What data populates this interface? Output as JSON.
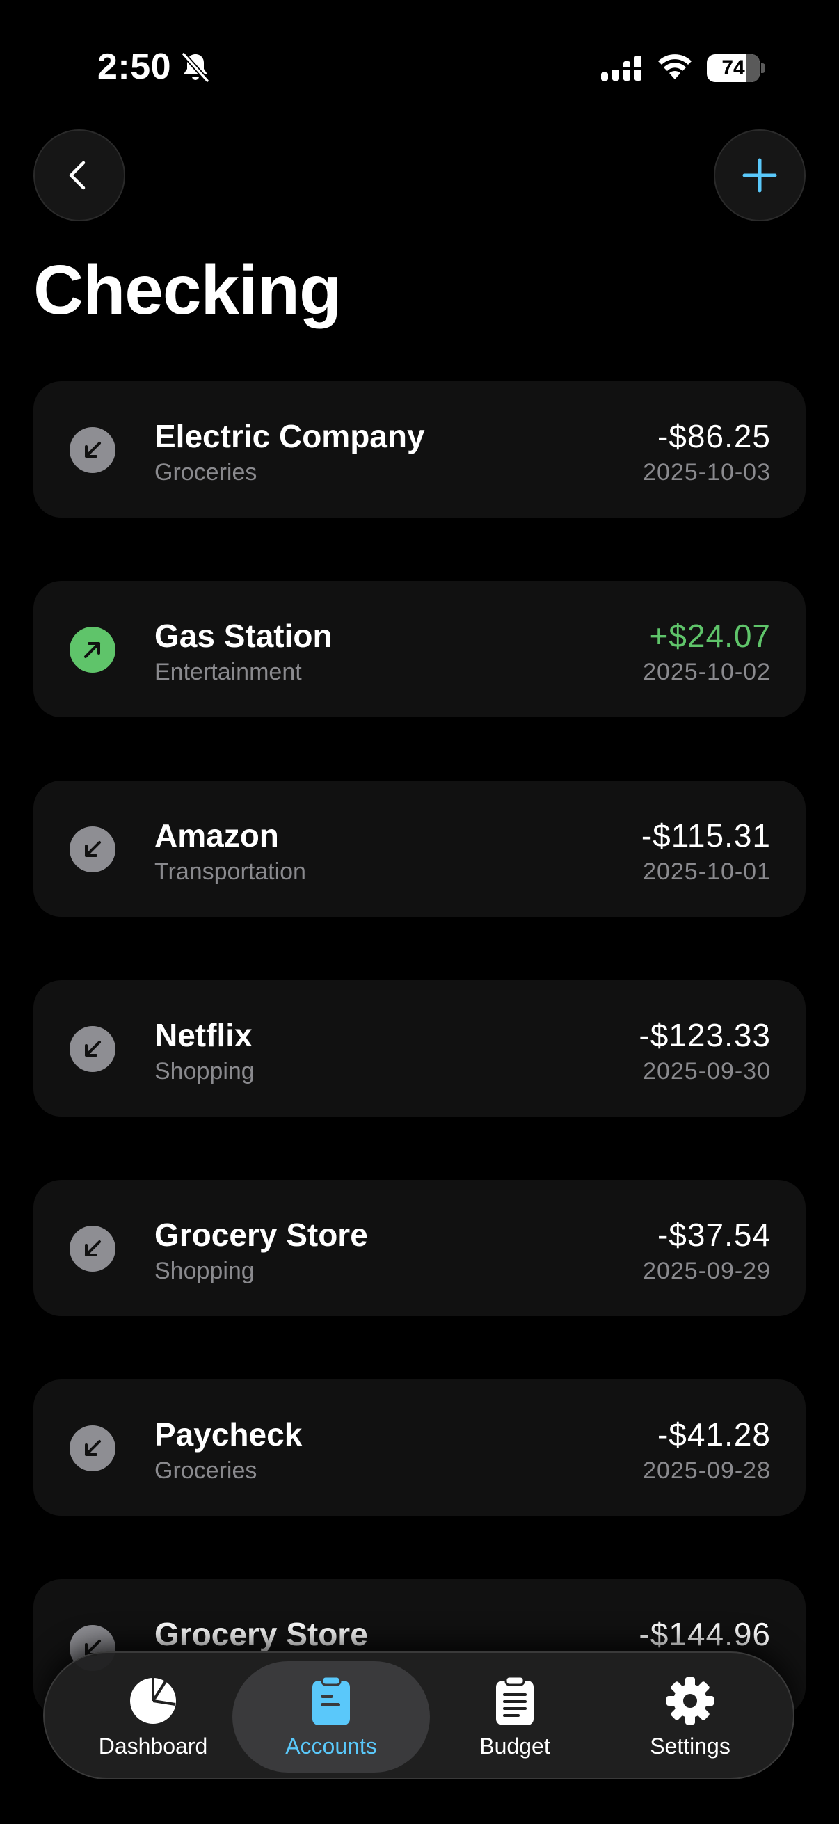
{
  "status_bar": {
    "time": "2:50",
    "battery": "74",
    "battery_level": 0.74
  },
  "header": {
    "back_icon": "chevron-left-icon",
    "add_icon": "plus-icon",
    "title": "Checking",
    "accent": "#5ac8fa"
  },
  "transactions": [
    {
      "name": "Electric Company",
      "category": "Groceries",
      "amount": "-$86.25",
      "date": "2025-10-03",
      "direction": "outgoing"
    },
    {
      "name": "Gas Station",
      "category": "Entertainment",
      "amount": "+$24.07",
      "date": "2025-10-02",
      "direction": "incoming"
    },
    {
      "name": "Amazon",
      "category": "Transportation",
      "amount": "-$115.31",
      "date": "2025-10-01",
      "direction": "outgoing"
    },
    {
      "name": "Netflix",
      "category": "Shopping",
      "amount": "-$123.33",
      "date": "2025-09-30",
      "direction": "outgoing"
    },
    {
      "name": "Grocery Store",
      "category": "Shopping",
      "amount": "-$37.54",
      "date": "2025-09-29",
      "direction": "outgoing"
    },
    {
      "name": "Paycheck",
      "category": "Groceries",
      "amount": "-$41.28",
      "date": "2025-09-28",
      "direction": "outgoing"
    },
    {
      "name": "Grocery Store",
      "category": "",
      "amount": "-$144.96",
      "date": "",
      "direction": "outgoing"
    }
  ],
  "colors": {
    "income": "#5fc46a",
    "outgoing_icon": "#8e8e93",
    "card": "#111111"
  },
  "tab_bar": {
    "tabs": [
      {
        "label": "Dashboard",
        "icon": "pie-chart-icon",
        "active": false
      },
      {
        "label": "Accounts",
        "icon": "clipboard-icon",
        "active": true
      },
      {
        "label": "Budget",
        "icon": "list-clipboard-icon",
        "active": false
      },
      {
        "label": "Settings",
        "icon": "gear-icon",
        "active": false
      }
    ]
  }
}
